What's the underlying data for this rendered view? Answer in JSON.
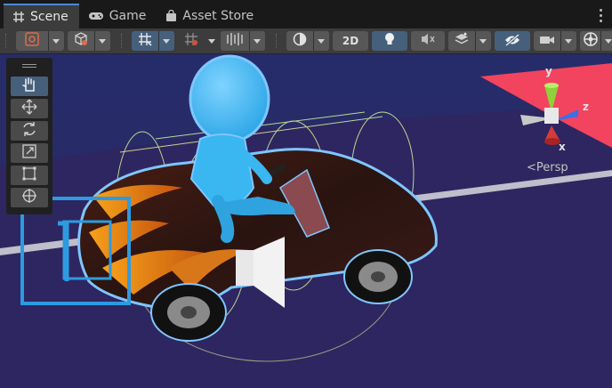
{
  "tabs": [
    {
      "label": "Scene",
      "icon": "hash-grid-icon",
      "active": true
    },
    {
      "label": "Game",
      "icon": "gamepad-icon",
      "active": false
    },
    {
      "label": "Asset Store",
      "icon": "shopping-bag-icon",
      "active": false
    }
  ],
  "toolbar": {
    "mode_2d_label": "2D",
    "items": [
      "draw-mode-dropdown",
      "render-path-dropdown",
      "grid-snapping-toggle",
      "increment-snap-dropdown",
      "grid-visibility-dropdown",
      "shading-mode-dropdown",
      "2d-toggle",
      "lighting-toggle",
      "audio-toggle",
      "effects-dropdown",
      "scene-visibility-toggle",
      "camera-dropdown",
      "gizmos-dropdown"
    ]
  },
  "tools": [
    "hand-tool",
    "move-tool",
    "rotate-tool",
    "scale-tool",
    "rect-tool",
    "transform-tool"
  ],
  "gizmo": {
    "projection_label": "Persp",
    "axis_labels": {
      "y": "y",
      "z": "z",
      "x": "x"
    },
    "colors": {
      "x": "#d43b3b",
      "y": "#8fd13a",
      "z": "#3a6fe8"
    }
  },
  "colors": {
    "sky": "#262c6a",
    "ground": "#2d2560",
    "road_red": "#f2445f",
    "selection_outline": "#7fc6ff",
    "character_blue": "#3ab6f0",
    "collider_lines": "#d9f29a",
    "ui_accent": "#46607c"
  }
}
